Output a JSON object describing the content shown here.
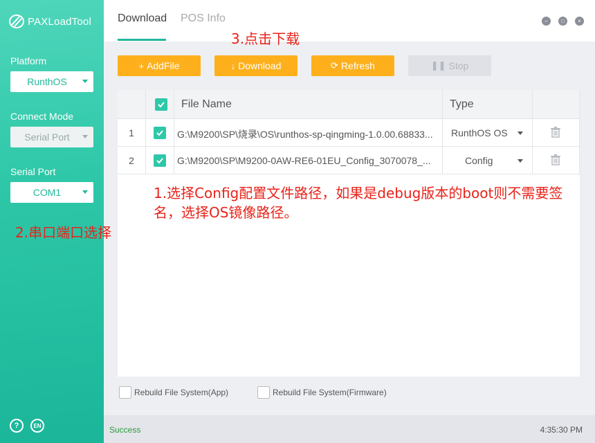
{
  "app": {
    "title": "PAXLoadTool"
  },
  "sidebar": {
    "platform": {
      "label": "Platform",
      "value": "RunthOS"
    },
    "connect_mode": {
      "label": "Connect Mode",
      "value": "Serial Port"
    },
    "serial_port": {
      "label": "Serial Port",
      "value": "COM1"
    },
    "help_icon": "?",
    "lang_icon": "EN"
  },
  "tabs": [
    {
      "label": "Download",
      "active": true
    },
    {
      "label": "POS Info",
      "active": false
    }
  ],
  "toolbar": {
    "addfile": "AddFile",
    "download": "Download",
    "refresh": "Refresh",
    "stop": "Stop"
  },
  "table": {
    "headers": {
      "file_name": "File Name",
      "type": "Type"
    },
    "rows": [
      {
        "num": "1",
        "checked": true,
        "file": "G:\\M9200\\SP\\烧录\\OS\\runthos-sp-qingming-1.0.00.68833...",
        "type": "RunthOS OS"
      },
      {
        "num": "2",
        "checked": true,
        "file": "G:\\M9200\\SP\\M9200-0AW-RE6-01EU_Config_3070078_...",
        "type": "Config"
      }
    ]
  },
  "options": {
    "rebuild_app": "Rebuild File System(App)",
    "rebuild_firmware": "Rebuild File System(Firmware)"
  },
  "status": {
    "message": "Success",
    "time": "4:35:30 PM"
  },
  "annotations": {
    "step1": "1.选择Config配置文件路径，如果是debug版本的boot则不需要签名，选择OS镜像路径。",
    "step2": "2.串口端口选择",
    "step3": "3.点击下载"
  },
  "colors": {
    "accent": "#2ec8a8",
    "button": "#fdb01c",
    "annotation": "#e8231a",
    "status_ok": "#2a9a3a"
  }
}
